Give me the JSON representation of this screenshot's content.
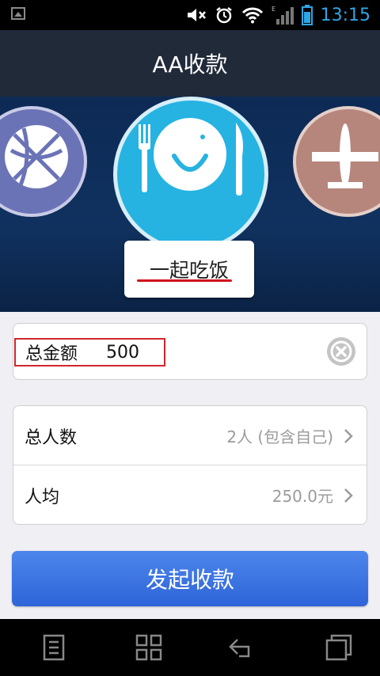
{
  "status_bar": {
    "time": "13:15"
  },
  "header": {
    "title": "AA收款"
  },
  "banner": {
    "categories": [
      {
        "icon": "basketball-icon"
      },
      {
        "icon": "dining-icon"
      },
      {
        "icon": "airplane-icon"
      }
    ],
    "selected_label": "一起吃饭"
  },
  "amount": {
    "label": "总金额",
    "value": "500"
  },
  "rows": [
    {
      "label": "总人数",
      "value": "2人 (包含自己)"
    },
    {
      "label": "人均",
      "value": "250.0元"
    }
  ],
  "primary_button": {
    "label": "发起收款"
  },
  "nav_bar": {
    "icons": [
      "menu-icon",
      "apps-icon",
      "back-icon",
      "recent-apps-icon"
    ]
  },
  "colors": {
    "accent_blue": "#3a72e0",
    "header_bg": "#202a39",
    "banner_bg": "#0f2d5a",
    "highlight_red": "#d0262f"
  }
}
